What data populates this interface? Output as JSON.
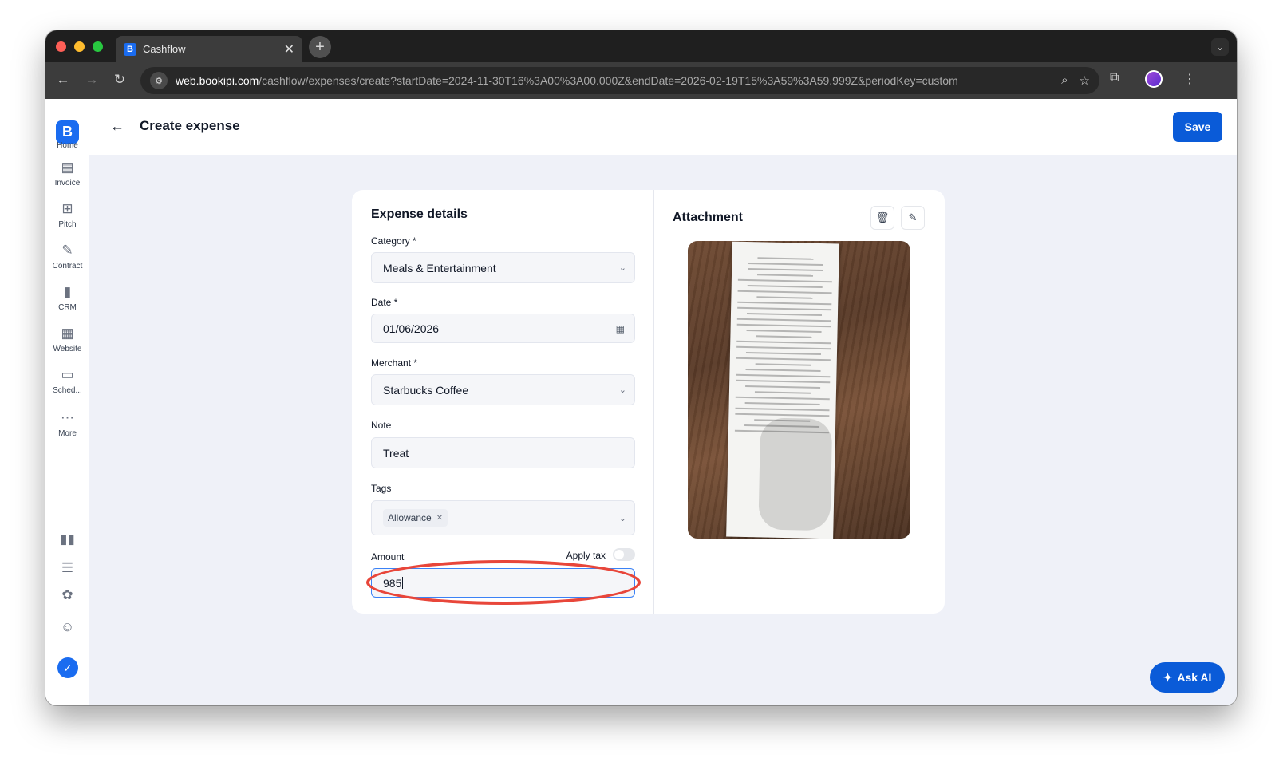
{
  "browser": {
    "tab_title": "Cashflow",
    "url_host": "web.bookipi.com",
    "url_path": "/cashflow/expenses/create?startDate=2024-11-30T16%3A00%3A00.000Z&endDate=2026-02-19T15%3A59%3A59.999Z&periodKey=custom"
  },
  "sidebar": {
    "items": [
      {
        "label": "Home",
        "icon": "bookipi-logo"
      },
      {
        "label": "Invoice",
        "icon": "invoice-icon"
      },
      {
        "label": "Pitch",
        "icon": "pitch-icon"
      },
      {
        "label": "Contract",
        "icon": "contract-icon"
      },
      {
        "label": "CRM",
        "icon": "crm-icon"
      },
      {
        "label": "Website",
        "icon": "website-icon"
      },
      {
        "label": "Sched...",
        "icon": "schedule-icon"
      },
      {
        "label": "More",
        "icon": "more-icon"
      }
    ]
  },
  "header": {
    "title": "Create expense",
    "save_label": "Save"
  },
  "details": {
    "title": "Expense details",
    "category_label": "Category *",
    "category_value": "Meals & Entertainment",
    "date_label": "Date *",
    "date_value": "01/06/2026",
    "merchant_label": "Merchant *",
    "merchant_value": "Starbucks Coffee",
    "note_label": "Note",
    "note_value": "Treat",
    "tags_label": "Tags",
    "tags": [
      "Allowance"
    ],
    "amount_label": "Amount",
    "apply_tax_label": "Apply tax",
    "apply_tax_on": false,
    "amount_value": "985"
  },
  "attachment": {
    "title": "Attachment"
  },
  "ask_ai_label": "Ask AI",
  "colors": {
    "primary": "#0a5bd8",
    "annotation": "#e8463a",
    "background": "#eff1f8"
  }
}
